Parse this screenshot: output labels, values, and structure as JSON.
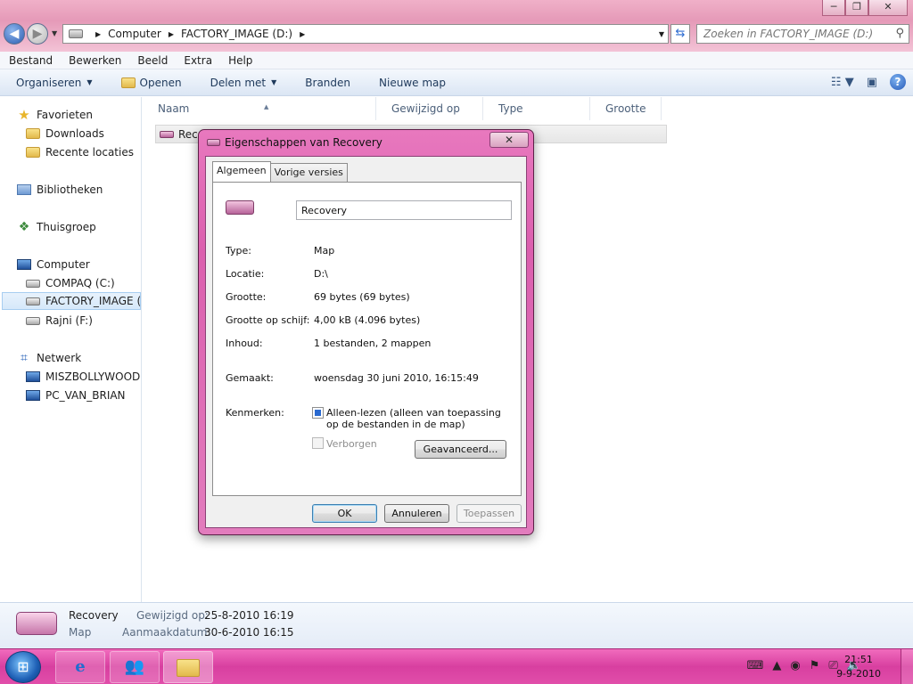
{
  "window": {
    "minimize_glyph": "─",
    "maximize_glyph": "❐",
    "close_glyph": "✕"
  },
  "address": {
    "segments": [
      "Computer",
      "FACTORY_IMAGE (D:)"
    ],
    "search_placeholder": "Zoeken in FACTORY_IMAGE (D:)"
  },
  "menubar": [
    "Bestand",
    "Bewerken",
    "Beeld",
    "Extra",
    "Help"
  ],
  "commandbar": {
    "organize": "Organiseren",
    "open": "Openen",
    "share": "Delen met",
    "burn": "Branden",
    "new_folder": "Nieuwe map"
  },
  "navpane": {
    "favorites": "Favorieten",
    "downloads": "Downloads",
    "recent": "Recente locaties",
    "libraries": "Bibliotheken",
    "homegroup": "Thuisgroep",
    "computer": "Computer",
    "drive_c": "COMPAQ (C:)",
    "drive_d": "FACTORY_IMAGE (D:)",
    "drive_f": "Rajni (F:)",
    "network": "Netwerk",
    "net1": "MISZBOLLYWOOD",
    "net2": "PC_VAN_BRIAN"
  },
  "filelist": {
    "columns": [
      "Naam",
      "Gewijzigd op",
      "Type",
      "Grootte"
    ],
    "rows": [
      {
        "name": "Recovery"
      }
    ]
  },
  "details": {
    "name": "Recovery",
    "type": "Map",
    "modified_label": "Gewijzigd op:",
    "modified_value": "25-8-2010 16:19",
    "created_label": "Aanmaakdatum:",
    "created_value": "30-6-2010 16:15"
  },
  "dialog": {
    "title": "Eigenschappen van Recovery",
    "tabs": [
      "Algemeen",
      "Vorige versies"
    ],
    "name_value": "Recovery",
    "props": {
      "type_label": "Type:",
      "type_value": "Map",
      "location_label": "Locatie:",
      "location_value": "D:\\",
      "size_label": "Grootte:",
      "size_value": "69 bytes (69 bytes)",
      "disk_label": "Grootte op schijf:",
      "disk_value": "4,00 kB (4.096 bytes)",
      "content_label": "Inhoud:",
      "content_value": "1 bestanden, 2 mappen",
      "created_label": "Gemaakt:",
      "created_value": "woensdag 30 juni 2010, 16:15:49",
      "attributes_label": "Kenmerken:"
    },
    "readonly_label": "Alleen-lezen (alleen van toepassing op de bestanden in de map)",
    "readonly_checked": true,
    "hidden_label": "Verborgen",
    "hidden_checked": false,
    "advanced_button": "Geavanceerd...",
    "ok": "OK",
    "cancel": "Annuleren",
    "apply": "Toepassen"
  },
  "taskbar": {
    "time": "21:51",
    "date": "9-9-2010"
  }
}
